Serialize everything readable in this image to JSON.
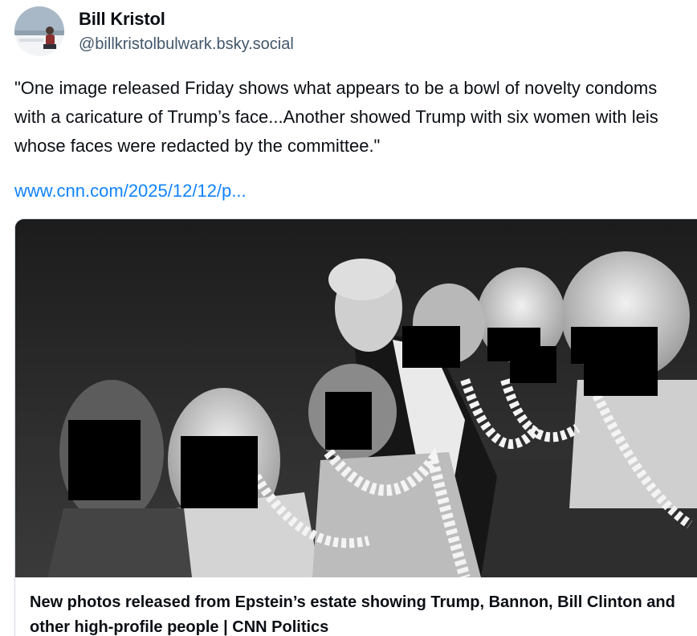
{
  "author": {
    "name": "Bill Kristol",
    "handle": "@billkristolbulwark.bsky.social"
  },
  "post": {
    "text": "\"One image released Friday shows what appears to be a bowl of novelty condoms with a caricature of Trump’s face...Another showed Trump with six women with leis whose faces were redacted by the committee.\"",
    "link": "www.cnn.com/2025/12/12/p..."
  },
  "embed": {
    "title": "New photos released from Epstein’s estate showing Trump, Bannon, Bill Clinton and other high-profile people | CNN Politics"
  },
  "colors": {
    "link": "#1083fe",
    "handle": "#42576c",
    "border": "#d4dbe2"
  }
}
